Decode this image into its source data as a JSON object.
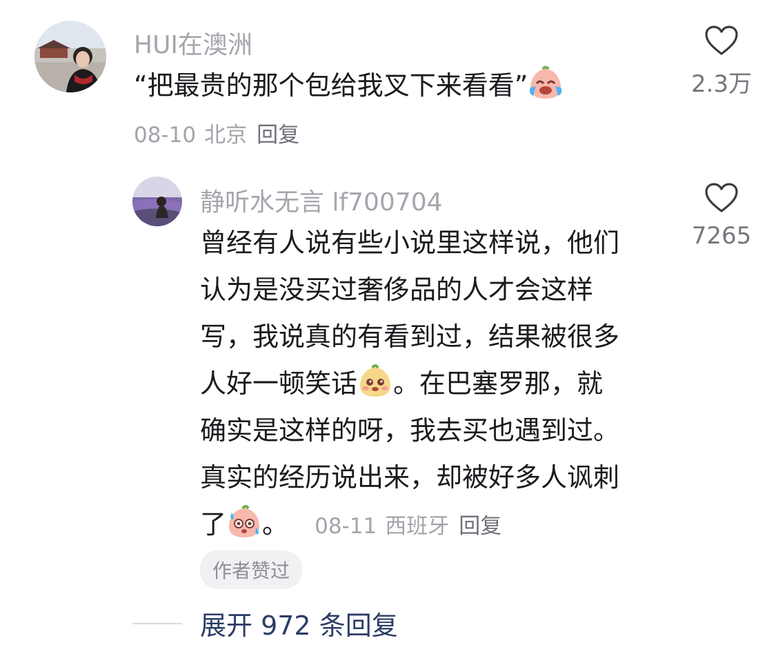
{
  "comment": {
    "username": "HUI在澳洲",
    "text": "“把最贵的那个包给我叉下来看看”",
    "date": "08-10",
    "location": "北京",
    "reply_label": "回复",
    "like_count": "2.3万",
    "emoji_icon": "laugh-cry-emoji"
  },
  "reply": {
    "username": "静听水无言 lf700704",
    "text_lines": [
      "曾经有人说有些小说里这样说，他们",
      "认为是没买过奢侈品的人才会这样",
      "写，我说真的有看到过，结果被很多",
      "人好一顿笑话",
      "。在巴塞罗那，就",
      "确实是这样的呀，我去买也遇到过。",
      "真实的经历说出来，却被好多人讽刺",
      "了",
      "。"
    ],
    "date": "08-11",
    "location": "西班牙",
    "reply_label": "回复",
    "like_count": "7265",
    "author_liked_label": "作者赞过",
    "emoji_icons": [
      "shy-emoji",
      "sweat-emoji"
    ]
  },
  "expand": {
    "label": "展开 972 条回复"
  },
  "colors": {
    "name": "#a4a6ad",
    "meta": "#a2a4ab",
    "expand": "#2c3d66"
  }
}
